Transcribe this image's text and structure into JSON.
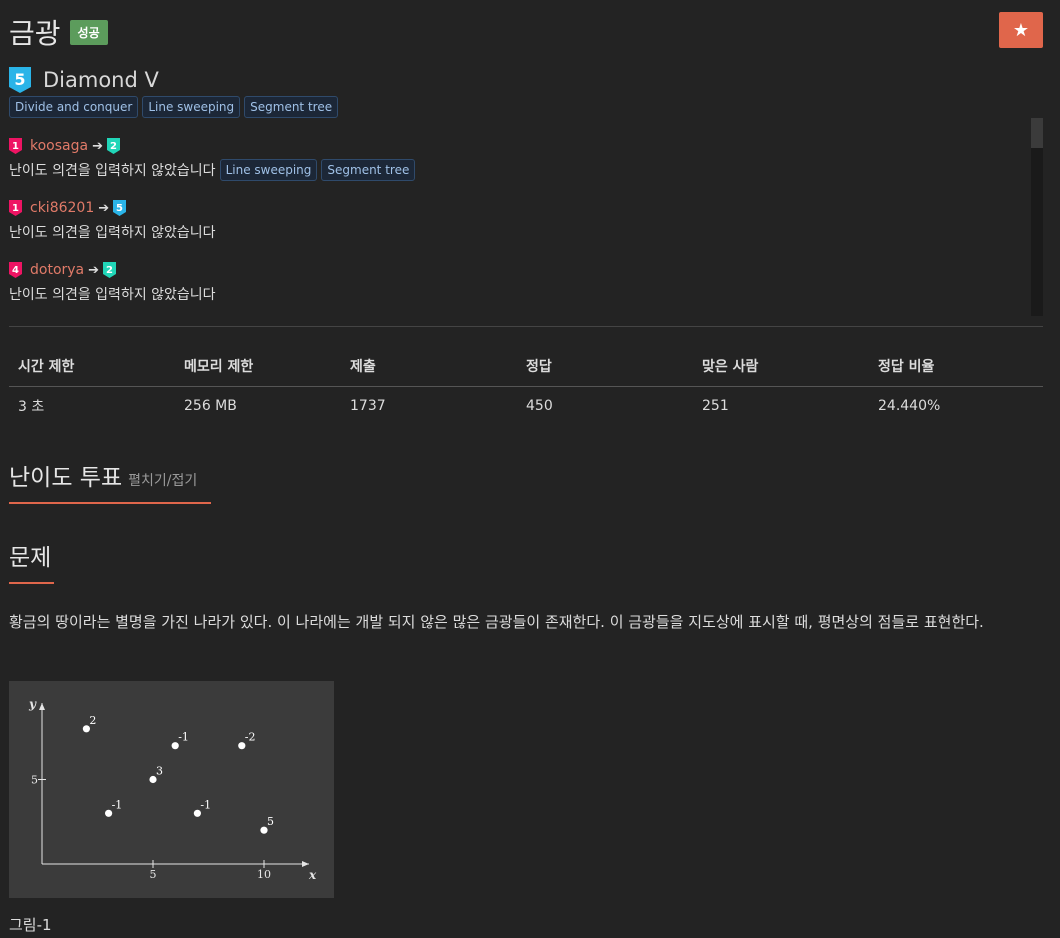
{
  "problem": {
    "title": "금광",
    "status_badge": "성공",
    "star": "★",
    "tier": {
      "level": "5",
      "name": "Diamond V",
      "color": "#2ab4e8"
    },
    "tags": [
      "Divide and conquer",
      "Line sweeping",
      "Segment tree"
    ]
  },
  "opinions": [
    {
      "from_level": "1",
      "from_color": "#ee1463",
      "user": "koosaga",
      "arrow": "➔",
      "to_level": "2",
      "to_color": "#21d6b8",
      "text": "난이도 의견을 입력하지 않았습니다",
      "tags": [
        "Line sweeping",
        "Segment tree"
      ]
    },
    {
      "from_level": "1",
      "from_color": "#ee1463",
      "user": "cki86201",
      "arrow": "➔",
      "to_level": "5",
      "to_color": "#2ab4e8",
      "text": "난이도 의견을 입력하지 않았습니다",
      "tags": []
    },
    {
      "from_level": "4",
      "from_color": "#ee1463",
      "user": "dotorya",
      "arrow": "➔",
      "to_level": "2",
      "to_color": "#21d6b8",
      "text": "난이도 의견을 입력하지 않았습니다",
      "tags": []
    }
  ],
  "info_table": {
    "headers": [
      "시간 제한",
      "메모리 제한",
      "제출",
      "정답",
      "맞은 사람",
      "정답 비율"
    ],
    "values": [
      "3 초",
      "256 MB",
      "1737",
      "450",
      "251",
      "24.440%"
    ]
  },
  "vote_section": {
    "title": "난이도 투표",
    "toggle": "펼치기/접기"
  },
  "problem_section": {
    "title": "문제",
    "description": "황금의 땅이라는 별명을 가진 나라가 있다. 이 나라에는 개발 되지 않은 많은 금광들이 존재한다. 이 금광들을 지도상에 표시할 때, 평면상의 점들로 표현한다.",
    "figure": {
      "y_label": "y",
      "x_label": "x",
      "x_ticks": [
        "5",
        "10"
      ],
      "y_ticks": [
        "5"
      ],
      "points": [
        {
          "x": 2,
          "y": 8,
          "label": "2"
        },
        {
          "x": 6,
          "y": 7,
          "label": "-1"
        },
        {
          "x": 9,
          "y": 7,
          "label": "-2"
        },
        {
          "x": 5,
          "y": 5,
          "label": "3"
        },
        {
          "x": 3,
          "y": 3,
          "label": "-1"
        },
        {
          "x": 7,
          "y": 3,
          "label": "-1"
        },
        {
          "x": 10,
          "y": 2,
          "label": "5"
        }
      ]
    },
    "caption": "그림-1"
  }
}
